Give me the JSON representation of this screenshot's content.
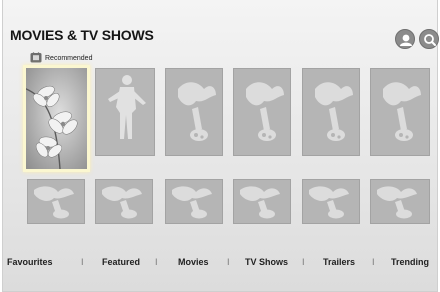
{
  "header": {
    "title": "MOVIES & TV SHOWS",
    "profile_icon": "person-icon",
    "search_icon": "search-icon"
  },
  "recommended": {
    "label": "Recommended",
    "icon": "recommended-icon"
  },
  "content_tiles": {
    "top_row": [
      "orchid-artwork",
      "person-silhouette",
      "placeholder",
      "placeholder",
      "placeholder"
    ],
    "bottom_row": [
      "placeholder",
      "placeholder",
      "placeholder",
      "placeholder",
      "placeholder",
      "placeholder"
    ],
    "selected": "orchid-artwork"
  },
  "tabs": {
    "items": [
      "Favourites",
      "Featured",
      "Movies",
      "TV Shows",
      "Trailers",
      "Trending"
    ],
    "separator": "I"
  },
  "colors": {
    "background": "#e8e8e8",
    "tile_gray": "#b5b5b5",
    "placeholder_graphic": "#dcdcdc",
    "selection_border": "#fbf7d0"
  }
}
